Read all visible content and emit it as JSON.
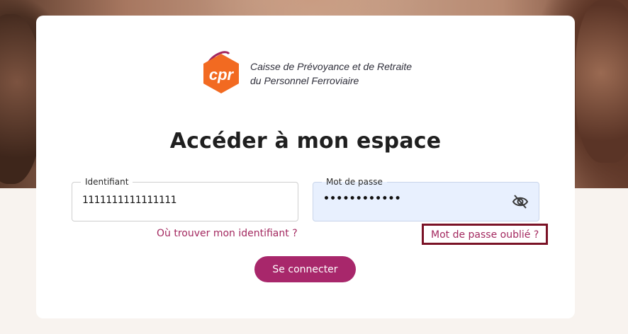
{
  "logo": {
    "badge_text": "cpr",
    "line1": "Caisse de Prévoyance et de Retraite",
    "line2": "du Personnel Ferroviaire",
    "brand_orange": "#f26a21",
    "brand_purple": "#a3285f"
  },
  "page": {
    "title": "Accéder à mon espace"
  },
  "form": {
    "identifiant": {
      "label": "Identifiant",
      "value": "1111111111111111"
    },
    "password": {
      "label": "Mot de passe",
      "value": "••••••••••••",
      "toggle_icon": "eye-slash-icon"
    },
    "link_identifiant": "Où trouver mon identifiant ?",
    "link_password": "Mot de passe oublié ?",
    "submit_label": "Se connecter"
  },
  "colors": {
    "accent": "#a8276b",
    "link": "#a3285f",
    "highlight_border": "#7a1226",
    "password_bg": "#e8f0fe"
  }
}
